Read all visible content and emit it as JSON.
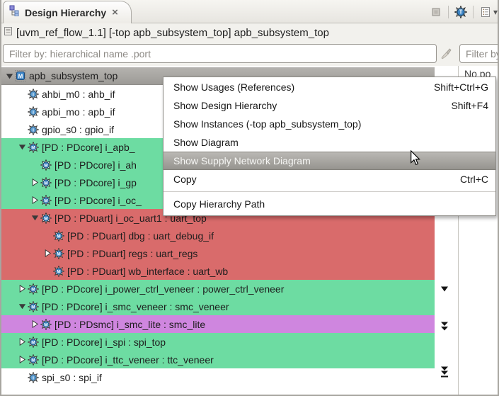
{
  "tab": {
    "title": "Design Hierarchy",
    "close_glyph": "×"
  },
  "toolbar": {
    "chevron_glyph": "▾",
    "icons": [
      "minimized-square-icon",
      "trace-module-icon",
      "view-menu-list-icon",
      "dropdown-chevron-icon"
    ]
  },
  "info_bar": {
    "text": "[uvm_ref_flow_1.1] [-top apb_subsystem_top] apb_subsystem_top"
  },
  "filters": {
    "left_placeholder": "Filter by: hierarchical name .port",
    "left_value": "",
    "right_placeholder": "Filter by",
    "right_value": ""
  },
  "right_panel": {
    "message": "No po"
  },
  "colors": {
    "green": "#6ddca2",
    "red": "#d96b6b",
    "purple": "#cf86df",
    "selection_gray_top": "#b4b2af",
    "selection_gray_bottom": "#9d9b97",
    "module_icon_blue": "#3f86c6",
    "interface_icon_blue": "#5f9fd4"
  },
  "tree": {
    "rows": [
      {
        "label": "apb_subsystem_top",
        "level": 0,
        "expander": "expanded",
        "icon": "module-chip",
        "bg": "selected"
      },
      {
        "label": "ahbi_m0 : ahb_if",
        "level": 1,
        "expander": "none",
        "icon": "interface",
        "bg": "white"
      },
      {
        "label": "apbi_mo : apb_if",
        "level": 1,
        "expander": "none",
        "icon": "interface",
        "bg": "white"
      },
      {
        "label": "gpio_s0 : gpio_if",
        "level": 1,
        "expander": "none",
        "icon": "interface",
        "bg": "white"
      },
      {
        "label": "[PD : PDcore] i_apb_",
        "level": 1,
        "expander": "expanded",
        "icon": "module",
        "bg": "green"
      },
      {
        "label": "[PD : PDcore] i_ah",
        "level": 2,
        "expander": "none",
        "icon": "module",
        "bg": "green"
      },
      {
        "label": "[PD : PDcore] i_gp",
        "level": 2,
        "expander": "collapsed",
        "icon": "module",
        "bg": "green"
      },
      {
        "label": "[PD : PDcore] i_oc_",
        "level": 2,
        "expander": "collapsed",
        "icon": "module",
        "bg": "green"
      },
      {
        "label": "[PD : PDuart] i_oc_uart1 : uart_top",
        "level": 2,
        "expander": "expanded",
        "icon": "module",
        "bg": "red"
      },
      {
        "label": "[PD : PDuart] dbg : uart_debug_if",
        "level": 3,
        "expander": "none",
        "icon": "module",
        "bg": "red"
      },
      {
        "label": "[PD : PDuart] regs : uart_regs",
        "level": 3,
        "expander": "collapsed",
        "icon": "module",
        "bg": "red"
      },
      {
        "label": "[PD : PDuart] wb_interface : uart_wb",
        "level": 3,
        "expander": "none",
        "icon": "module",
        "bg": "red"
      },
      {
        "label": "[PD : PDcore] i_power_ctrl_veneer : power_ctrl_veneer",
        "level": 1,
        "expander": "collapsed",
        "icon": "module",
        "bg": "green"
      },
      {
        "label": "[PD : PDcore] i_smc_veneer : smc_veneer",
        "level": 1,
        "expander": "expanded",
        "icon": "module",
        "bg": "green"
      },
      {
        "label": "[PD : PDsmc] i_smc_lite : smc_lite",
        "level": 2,
        "expander": "collapsed",
        "icon": "module",
        "bg": "purple"
      },
      {
        "label": "[PD : PDcore] i_spi : spi_top",
        "level": 1,
        "expander": "collapsed",
        "icon": "module",
        "bg": "green"
      },
      {
        "label": "[PD : PDcore] i_ttc_veneer : ttc_veneer",
        "level": 1,
        "expander": "collapsed",
        "icon": "module",
        "bg": "green"
      },
      {
        "label": "spi_s0 : spi_if",
        "level": 1,
        "expander": "none",
        "icon": "interface",
        "bg": "white"
      }
    ]
  },
  "context_menu": {
    "items": [
      {
        "label": "Show Usages (References)",
        "shortcut": "Shift+Ctrl+G",
        "highlighted": false
      },
      {
        "label": "Show Design Hierarchy",
        "shortcut": "Shift+F4",
        "highlighted": false
      },
      {
        "label": "Show Instances (-top apb_subsystem_top)",
        "shortcut": "",
        "highlighted": false
      },
      {
        "label": "Show Diagram",
        "shortcut": "",
        "highlighted": false
      },
      {
        "label": "Show Supply Network Diagram",
        "shortcut": "",
        "highlighted": true
      },
      {
        "label": "Copy",
        "shortcut": "Ctrl+C",
        "highlighted": false
      },
      {
        "type": "separator"
      },
      {
        "label": "Copy Hierarchy Path",
        "shortcut": "",
        "highlighted": false
      }
    ]
  }
}
